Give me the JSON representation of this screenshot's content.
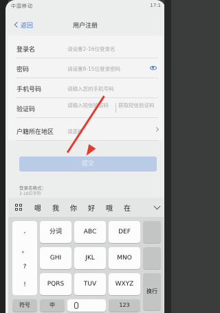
{
  "status_bar": {
    "sim": "中国移动",
    "time": "17:1"
  },
  "nav": {
    "back_label": "返回",
    "title": "用户注册"
  },
  "form": {
    "fields": [
      {
        "label": "登录名",
        "placeholder": "请设置2-16位登录名"
      },
      {
        "label": "密码",
        "placeholder": "请设置8-15位登录密码"
      },
      {
        "label": "手机号码",
        "placeholder": "请输入您的手机号码"
      },
      {
        "label": "验证码",
        "placeholder": "请输入短信验证码",
        "action": "获取短信验证码"
      },
      {
        "label": "户籍所在地区",
        "placeholder": "请选择"
      }
    ],
    "submit_label": "提交",
    "hint_title": "登录名格式：",
    "hint_detail": "2-16位字符"
  },
  "keyboard": {
    "candidates": [
      "嗯",
      "我",
      "你",
      "好",
      "哦",
      "在"
    ],
    "punctuation": [
      ",",
      "。",
      "?",
      "!"
    ],
    "rows": [
      [
        "分词",
        "ABC",
        "DEF"
      ],
      [
        "GHI",
        "JKL",
        "MNO"
      ],
      [
        "PQRS",
        "TUV",
        "WXYZ"
      ]
    ],
    "bottom": {
      "symbols": "符号",
      "lang": "中",
      "num": "123",
      "enter": "换行"
    }
  },
  "colors": {
    "accent": "#4a78c2",
    "arrow": "#e53a2e",
    "submit_bg": "#b9cbe6"
  }
}
